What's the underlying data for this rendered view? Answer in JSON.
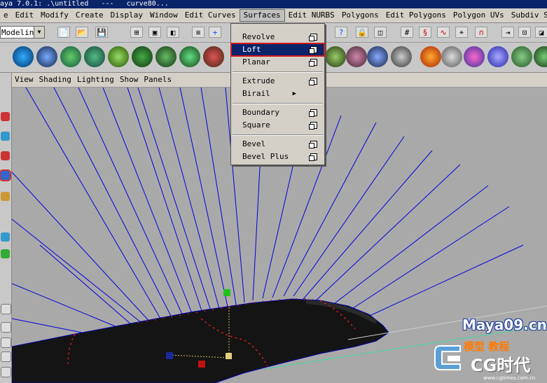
{
  "window": {
    "title": "aya 7.0.1: .\\untitled   ---   curve80..."
  },
  "menubar": {
    "items": [
      "e",
      "Edit",
      "Modify",
      "Create",
      "Display",
      "Window",
      "Edit Curves",
      "Surfaces",
      "Edit NURBS",
      "Polygons",
      "Edit Polygons",
      "Polygon UVs",
      "Subdiv Surfaces"
    ],
    "active": "Surfaces"
  },
  "statusline": {
    "mode": "Modeling"
  },
  "panel_menu": [
    "View",
    "Shading",
    "Lighting",
    "Show",
    "Panels"
  ],
  "surfaces_menu": {
    "items": [
      {
        "label": "Revolve",
        "has_options": true,
        "submenu": false
      },
      {
        "label": "Loft",
        "has_options": true,
        "submenu": false,
        "selected": true
      },
      {
        "label": "Planar",
        "has_options": true,
        "submenu": false
      },
      {
        "label": "Extrude",
        "has_options": true,
        "submenu": false
      },
      {
        "label": "Birail",
        "has_options": false,
        "submenu": true
      },
      {
        "label": "Boundary",
        "has_options": true,
        "submenu": false
      },
      {
        "label": "Square",
        "has_options": true,
        "submenu": false
      },
      {
        "label": "Bevel",
        "has_options": true,
        "submenu": false
      },
      {
        "label": "Bevel Plus",
        "has_options": true,
        "submenu": false
      }
    ]
  },
  "watermark": {
    "site": "Maya09.cn",
    "chinese": "模型 教程",
    "brand": "CG时代",
    "url": "www.cgtimes.com.cn"
  },
  "colors": {
    "viewport_bg": "#a9a9a9",
    "curve_blue": "#0000dd",
    "surface_dark": "#141414",
    "selection_red": "#d21b1b",
    "menu_highlight": "#0a246a"
  }
}
